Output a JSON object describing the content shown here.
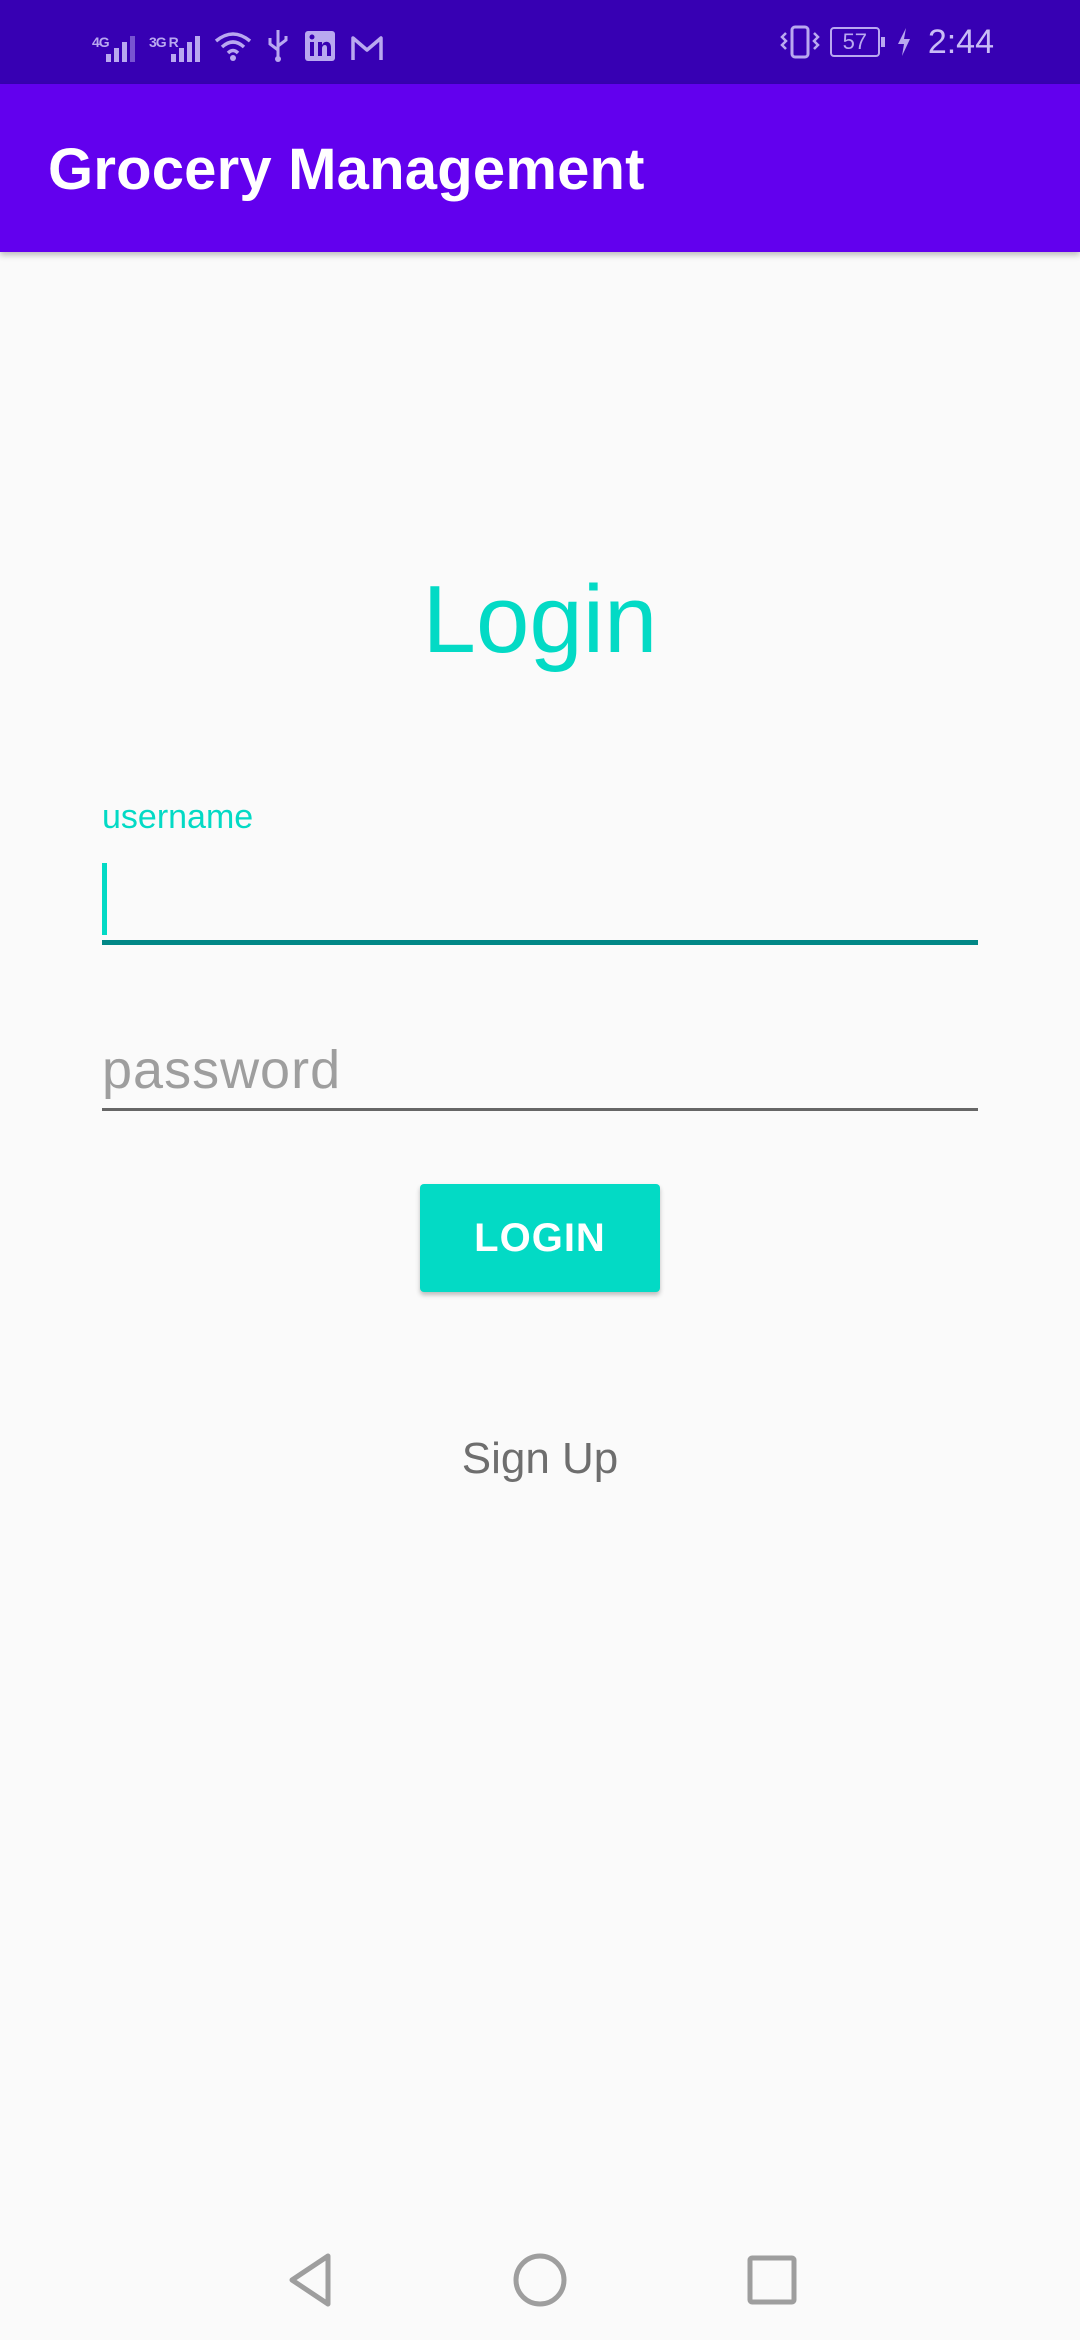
{
  "status_bar": {
    "network_1": "4G",
    "network_2": "3G R",
    "battery": "57",
    "time": "2:44",
    "icons": [
      "signal-icon",
      "signal-icon",
      "wifi-icon",
      "usb-icon",
      "linkedin-icon",
      "gmail-icon",
      "vibrate-icon",
      "battery-icon",
      "charging-icon"
    ]
  },
  "app_bar": {
    "title": "Grocery Management"
  },
  "login": {
    "heading": "Login",
    "username_label": "username",
    "username_value": "",
    "password_placeholder": "password",
    "password_value": "",
    "login_button": "LOGIN",
    "signup_link": "Sign Up"
  },
  "nav_bar": {
    "icons": [
      "back-icon",
      "home-icon",
      "recents-icon"
    ]
  },
  "colors": {
    "primary": "#6200ee",
    "primary_dark": "#3700b3",
    "accent": "#03dac5",
    "field_underline_active": "#018786",
    "background": "#fafafa"
  }
}
